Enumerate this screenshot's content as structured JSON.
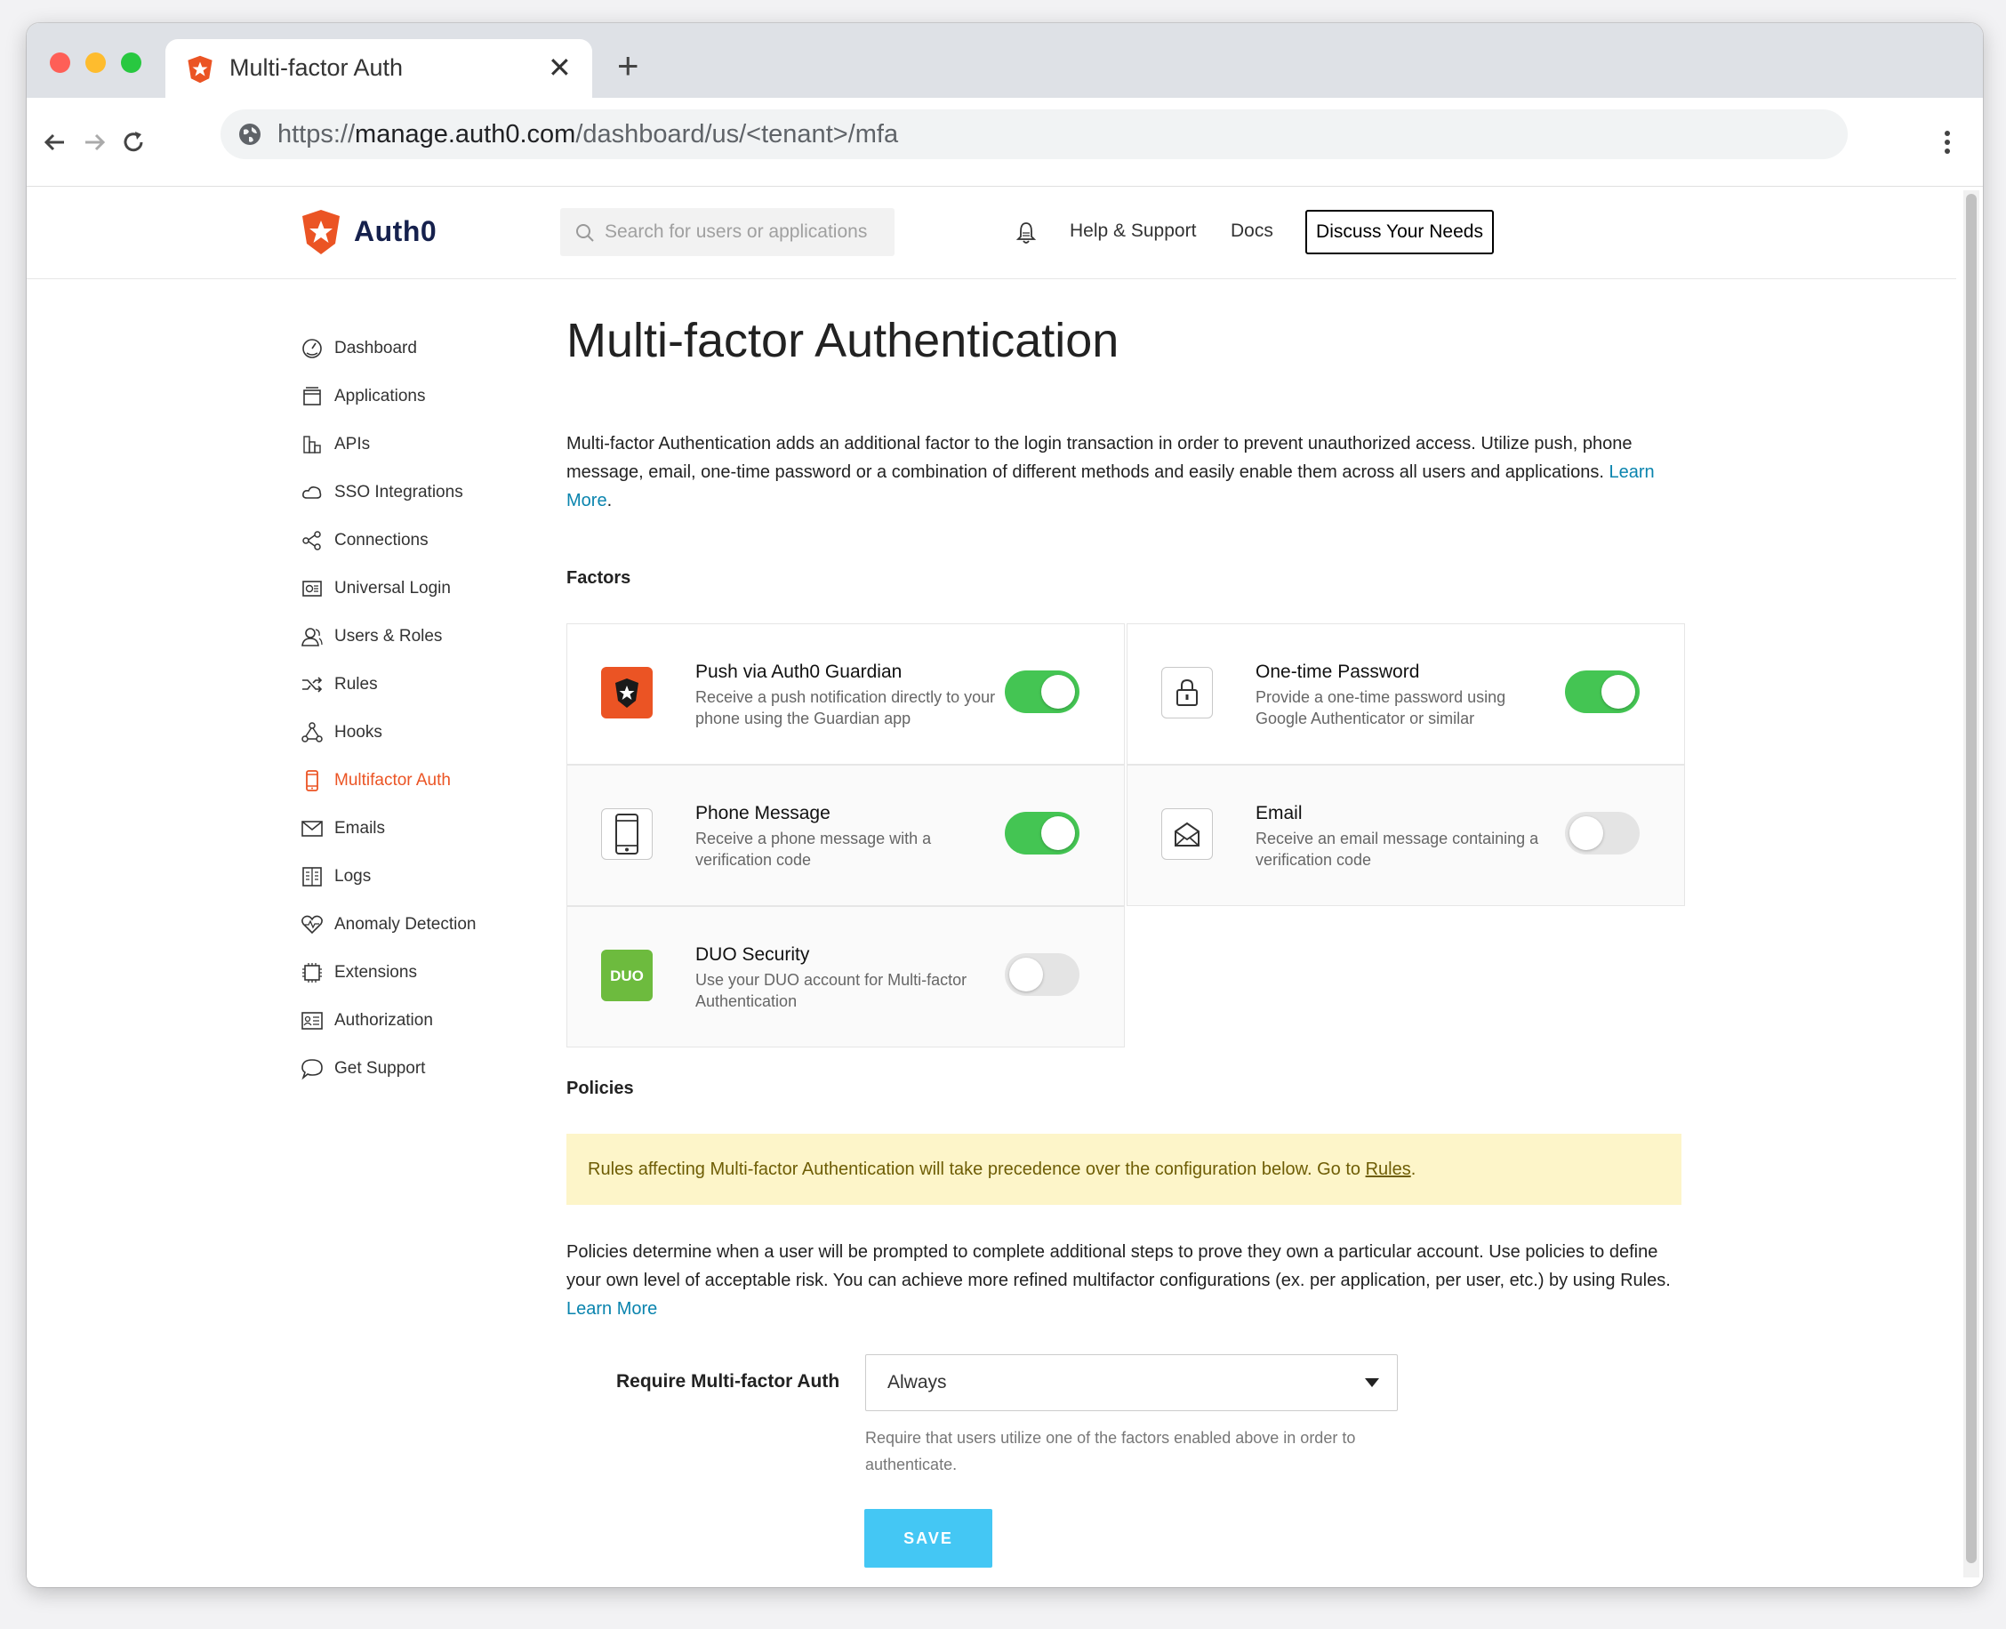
{
  "browser": {
    "tab_title": "Multi-factor Auth",
    "url_prefix": "https://",
    "url_domain": "manage.auth0.com",
    "url_path": "/dashboard/us/<tenant>/mfa"
  },
  "header": {
    "brand": "Auth0",
    "search_placeholder": "Search for users or applications",
    "help_link": "Help & Support",
    "docs_link": "Docs",
    "discuss_button": "Discuss Your Needs"
  },
  "sidebar": {
    "items": [
      {
        "label": "Dashboard",
        "icon": "dashboard-icon"
      },
      {
        "label": "Applications",
        "icon": "applications-icon"
      },
      {
        "label": "APIs",
        "icon": "apis-icon"
      },
      {
        "label": "SSO Integrations",
        "icon": "cloud-icon"
      },
      {
        "label": "Connections",
        "icon": "connections-icon"
      },
      {
        "label": "Universal Login",
        "icon": "universal-login-icon"
      },
      {
        "label": "Users & Roles",
        "icon": "users-icon"
      },
      {
        "label": "Rules",
        "icon": "shuffle-icon"
      },
      {
        "label": "Hooks",
        "icon": "hooks-icon"
      },
      {
        "label": "Multifactor Auth",
        "icon": "phone-icon",
        "active": true
      },
      {
        "label": "Emails",
        "icon": "envelope-icon"
      },
      {
        "label": "Logs",
        "icon": "book-icon"
      },
      {
        "label": "Anomaly Detection",
        "icon": "heart-pulse-icon"
      },
      {
        "label": "Extensions",
        "icon": "chip-icon"
      },
      {
        "label": "Authorization",
        "icon": "id-card-icon"
      },
      {
        "label": "Get Support",
        "icon": "chat-bubble-icon"
      }
    ]
  },
  "main": {
    "title": "Multi-factor Authentication",
    "description": "Multi-factor Authentication adds an additional factor to the login transaction in order to prevent unauthorized access. Utilize push, phone message, email, one-time password or a combination of different methods and easily enable them across all users and applications.",
    "learn_more": "Learn More",
    "factors_title": "Factors",
    "factors": [
      {
        "title": "Push via Auth0 Guardian",
        "description": "Receive a push notification directly to your phone using the Guardian app",
        "enabled": true,
        "icon": "guardian-icon"
      },
      {
        "title": "One-time Password",
        "description": "Provide a one-time password using Google Authenticator or similar",
        "enabled": true,
        "icon": "lock-icon"
      },
      {
        "title": "Phone Message",
        "description": "Receive a phone message with a verification code",
        "enabled": true,
        "icon": "mobile-phone-icon"
      },
      {
        "title": "Email",
        "description": "Receive an email message containing a verification code",
        "enabled": false,
        "icon": "email-icon"
      },
      {
        "title": "DUO Security",
        "description": "Use your DUO account for Multi-factor Authentication",
        "enabled": false,
        "icon": "duo-icon"
      }
    ],
    "policies_title": "Policies",
    "notice_text": "Rules affecting Multi-factor Authentication will take precedence over the configuration below. Go to ",
    "notice_link": "Rules",
    "policies_description": "Policies determine when a user will be prompted to complete additional steps to prove they own a particular account. Use policies to define your own level of acceptable risk. You can achieve more refined multifactor configurations (ex. per application, per user, etc.) by using Rules.",
    "policies_learn_more": "Learn More",
    "require_label": "Require Multi-factor Auth",
    "require_value": "Always",
    "require_hint": "Require that users utilize one of the factors enabled above in order to authenticate.",
    "save_button": "SAVE"
  },
  "colors": {
    "brand": "#eb5424",
    "toggle_on": "#44c553",
    "link": "#0a84ae",
    "save": "#44c7f4",
    "notice_bg": "#fdf5c9"
  }
}
